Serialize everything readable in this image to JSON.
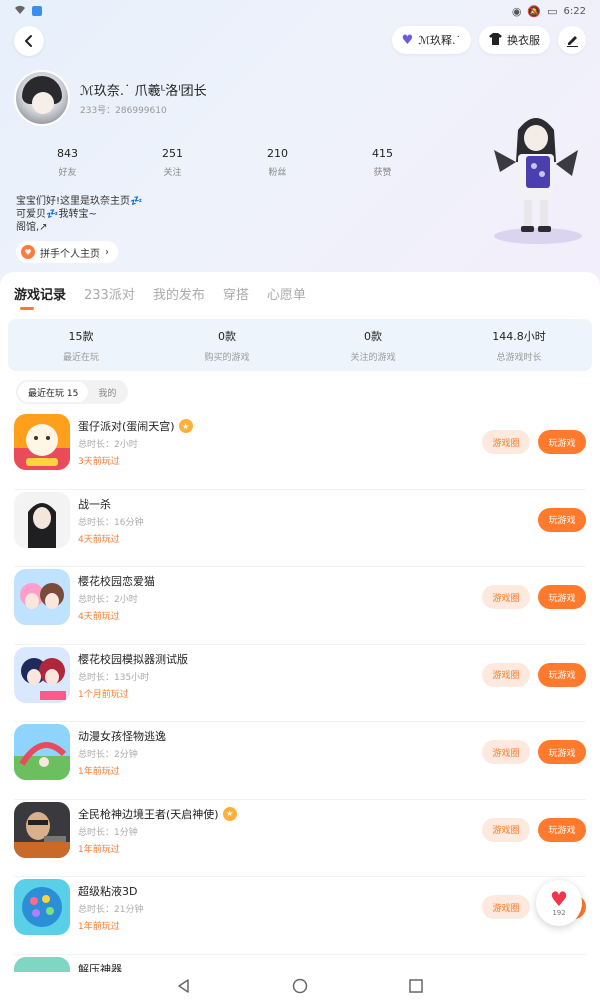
{
  "status_bar": {
    "time": "6:22",
    "icons": [
      "wifi-icon",
      "app-icon",
      "eye-icon",
      "mute-icon",
      "battery-icon"
    ]
  },
  "header": {
    "tag_label": "ℳ玖释.˙",
    "outfit_label": "换衣服",
    "icons": {
      "back": "chevron-left-icon",
      "tag": "purple-heart-icon",
      "outfit": "shirt-icon",
      "edit": "pen-icon"
    }
  },
  "profile": {
    "name": "ℳ玖奈.˙ 爪羲ᴸ洛ᴵ团长",
    "id": "233号：286999610",
    "stats": [
      {
        "value": "843",
        "label": "好友"
      },
      {
        "value": "251",
        "label": "关注"
      },
      {
        "value": "210",
        "label": "粉丝"
      },
      {
        "value": "415",
        "label": "获赞"
      }
    ],
    "bio": [
      "宝宝们好!这里是玖奈主页💤",
      "可爱贝💤我转宝~",
      "阁馆,↗"
    ],
    "store_label": "拼手个人主页"
  },
  "tabs": [
    "游戏记录",
    "233派对",
    "我的发布",
    "穿搭",
    "心愿单"
  ],
  "summary": [
    {
      "value": "15款",
      "label": "最近在玩"
    },
    {
      "value": "0款",
      "label": "购买的游戏"
    },
    {
      "value": "0款",
      "label": "关注的游戏"
    },
    {
      "value": "144.8小时",
      "label": "总游戏时长"
    }
  ],
  "filter": {
    "recent": "最近在玩 15",
    "bought": "我的"
  },
  "games": [
    {
      "name": "蛋仔派对(蛋闹天宫)",
      "duration": "总时长：2小时",
      "last": "3天前玩过",
      "badge": true,
      "has_circle": true
    },
    {
      "name": "战一杀",
      "duration": "总时长：16分钟",
      "last": "4天前玩过",
      "badge": false,
      "has_circle": false
    },
    {
      "name": "樱花校园恋爱猫",
      "duration": "总时长：2小时",
      "last": "4天前玩过",
      "badge": false,
      "has_circle": true
    },
    {
      "name": "樱花校园模拟器测试版",
      "duration": "总时长：135小时",
      "last": "1个月前玩过",
      "badge": false,
      "has_circle": true
    },
    {
      "name": "动漫女孩怪物逃逸",
      "duration": "总时长：2分钟",
      "last": "1年前玩过",
      "badge": false,
      "has_circle": true
    },
    {
      "name": "全民枪神边境王者(天启神使)",
      "duration": "总时长：1分钟",
      "last": "1年前玩过",
      "badge": true,
      "has_circle": true
    },
    {
      "name": "超级粘液3D",
      "duration": "总时长：21分钟",
      "last": "1年前玩过",
      "badge": false,
      "has_circle": true
    },
    {
      "name": "解压神器",
      "duration": "",
      "last": "",
      "badge": false,
      "has_circle": false
    }
  ],
  "buttons": {
    "circle": "游戏圈",
    "play": "玩游戏"
  },
  "fab": {
    "count": "192"
  },
  "colors": {
    "accent": "#ff7a2d",
    "accent_light": "#fde9de",
    "summary_bg": "#eef4fb"
  }
}
